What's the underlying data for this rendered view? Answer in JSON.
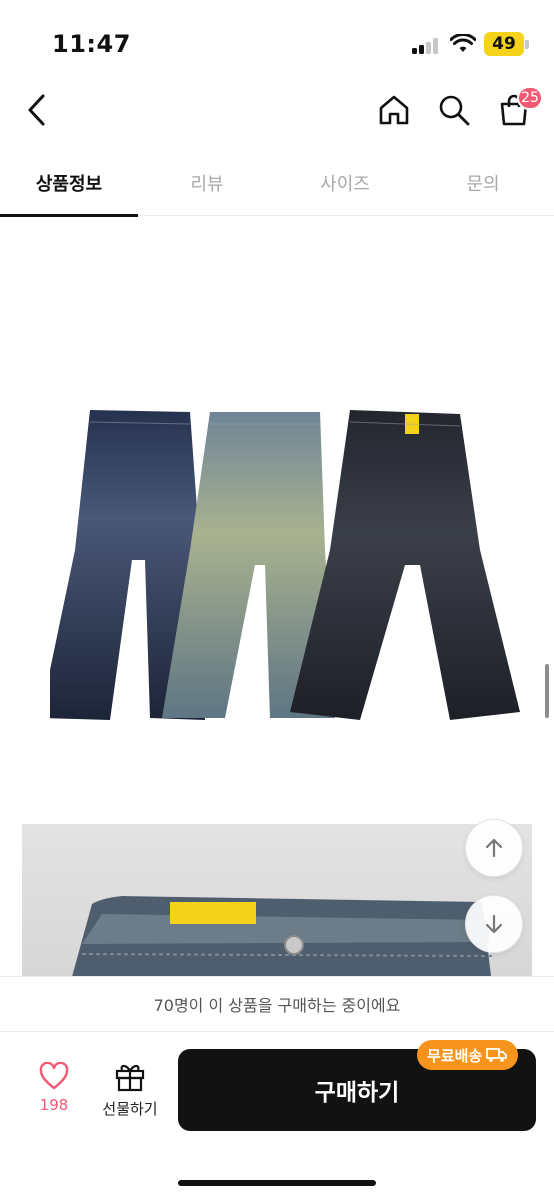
{
  "status_bar": {
    "time": "11:47",
    "battery_level": "49"
  },
  "header": {
    "cart_badge": "25",
    "icons": [
      "chevron-left-icon",
      "home-icon",
      "search-icon",
      "shopping-bag-icon"
    ]
  },
  "tabs": [
    {
      "label": "상품정보",
      "active": true
    },
    {
      "label": "리뷰",
      "active": false
    },
    {
      "label": "사이즈",
      "active": false
    },
    {
      "label": "문의",
      "active": false
    }
  ],
  "notice": {
    "text": "70명이 이 상품을 구매하는 중이에요"
  },
  "bottom_bar": {
    "like_count": "198",
    "gift_label": "선물하기",
    "buy_label": "구매하기",
    "free_shipping_label": "무료배송"
  },
  "colors": {
    "accent": "#f15a74",
    "shipping_badge": "#f7941d",
    "buy_button": "#121212",
    "battery": "#f6d31a"
  }
}
